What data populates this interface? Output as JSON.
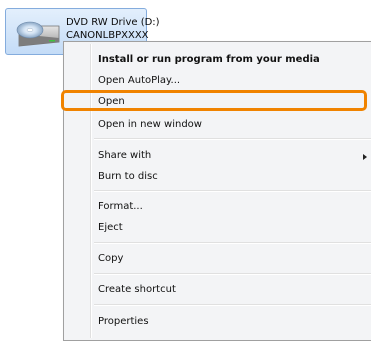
{
  "drive": {
    "name": "DVD RW Drive (D:)",
    "label": "CANONLBPXXXX"
  },
  "menu": {
    "items": [
      {
        "label": "Install or run program from your media",
        "bold": true
      },
      {
        "label": "Open AutoPlay..."
      },
      {
        "label": "Open",
        "highlighted": true
      },
      {
        "label": "Open in new window"
      },
      {
        "label": "Share with",
        "submenu": true
      },
      {
        "label": "Burn to disc"
      },
      {
        "label": "Format..."
      },
      {
        "label": "Eject"
      },
      {
        "label": "Copy"
      },
      {
        "label": "Create shortcut"
      },
      {
        "label": "Properties"
      }
    ]
  },
  "colors": {
    "highlight": "#f08300",
    "selection_border": "#84acdd"
  }
}
